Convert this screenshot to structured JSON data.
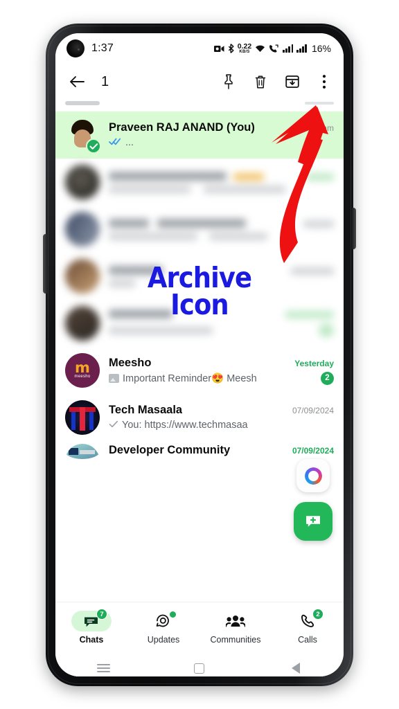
{
  "status_bar": {
    "time": "1:37",
    "data_rate_value": "0.22",
    "data_rate_unit": "KB/S",
    "battery": "16%",
    "icons": [
      "camera-icon",
      "bluetooth-icon",
      "data-rate-icon",
      "wifi-icon",
      "call-forward-icon",
      "signal-bars-sim1-icon",
      "signal-bars-sim2-icon"
    ]
  },
  "selection_toolbar": {
    "back_label": "back-arrow",
    "selected_count": "1",
    "actions": [
      {
        "name": "pin-button",
        "label": "Pin"
      },
      {
        "name": "delete-button",
        "label": "Delete"
      },
      {
        "name": "archive-button",
        "label": "Archive"
      },
      {
        "name": "overflow-menu-button",
        "label": "More options"
      }
    ]
  },
  "chat_list": [
    {
      "id": "partial-top",
      "name": "",
      "message": "",
      "time": "",
      "state": "partially-scrolled",
      "selected": false,
      "blurred": false
    },
    {
      "id": "praveen-raj-anand",
      "name": "Praveen RAJ ANAND (You)",
      "message": "...",
      "time": "am",
      "receipt": "read-double-check",
      "selected": true,
      "blurred": false,
      "unread": ""
    },
    {
      "id": "blurred-1",
      "name": "",
      "message": "",
      "time": "",
      "selected": false,
      "blurred": true
    },
    {
      "id": "blurred-2",
      "name": "",
      "message": "",
      "time": "",
      "selected": false,
      "blurred": true
    },
    {
      "id": "blurred-3",
      "name": "",
      "message": "",
      "time": "",
      "selected": false,
      "blurred": true
    },
    {
      "id": "blurred-4",
      "name": "",
      "message": "",
      "time": "",
      "selected": false,
      "blurred": true
    },
    {
      "id": "meesho",
      "name": "Meesho",
      "message": "Important Reminder😍  Meesh",
      "time": "Yesterday",
      "unread": "2",
      "has_image_preview": true,
      "selected": false,
      "blurred": false
    },
    {
      "id": "tech-masaala",
      "name": "Tech Masaala",
      "message": "You: https://www.techmasaa",
      "time": "07/09/2024",
      "receipt": "sent-single-check",
      "selected": false,
      "blurred": false,
      "unread": ""
    },
    {
      "id": "developer-community",
      "name": "Developer Community",
      "message": "",
      "time": "07/09/2024",
      "selected": false,
      "blurred": false,
      "unread": ""
    }
  ],
  "floating": {
    "fab_label": "new-chat",
    "assistant_label": "copilot-assistant"
  },
  "bottom_nav": [
    {
      "id": "chats",
      "label": "Chats",
      "icon": "chats-icon",
      "badge": "7",
      "dot": false,
      "active": true
    },
    {
      "id": "updates",
      "label": "Updates",
      "icon": "updates-status-icon",
      "badge": "",
      "dot": true,
      "active": false
    },
    {
      "id": "communities",
      "label": "Communities",
      "icon": "communities-icon",
      "badge": "",
      "dot": false,
      "active": false
    },
    {
      "id": "calls",
      "label": "Calls",
      "icon": "calls-icon",
      "badge": "2",
      "dot": false,
      "active": false
    }
  ],
  "android_nav": [
    {
      "id": "recents",
      "label": "recents-icon"
    },
    {
      "id": "home",
      "label": "home-icon"
    },
    {
      "id": "back",
      "label": "back-icon"
    }
  ],
  "annotation": {
    "text_line1": "Archive",
    "text_line2": "Icon",
    "text_color": "#1b1ae0",
    "arrow_color": "#ee1111",
    "arrow_points_to": "archive-button"
  },
  "colors": {
    "brand_green": "#1fad5b",
    "fab_green": "#22b758",
    "selected_row_bg": "#d9fbd4",
    "nav_active_pill": "#d6f7d7"
  }
}
